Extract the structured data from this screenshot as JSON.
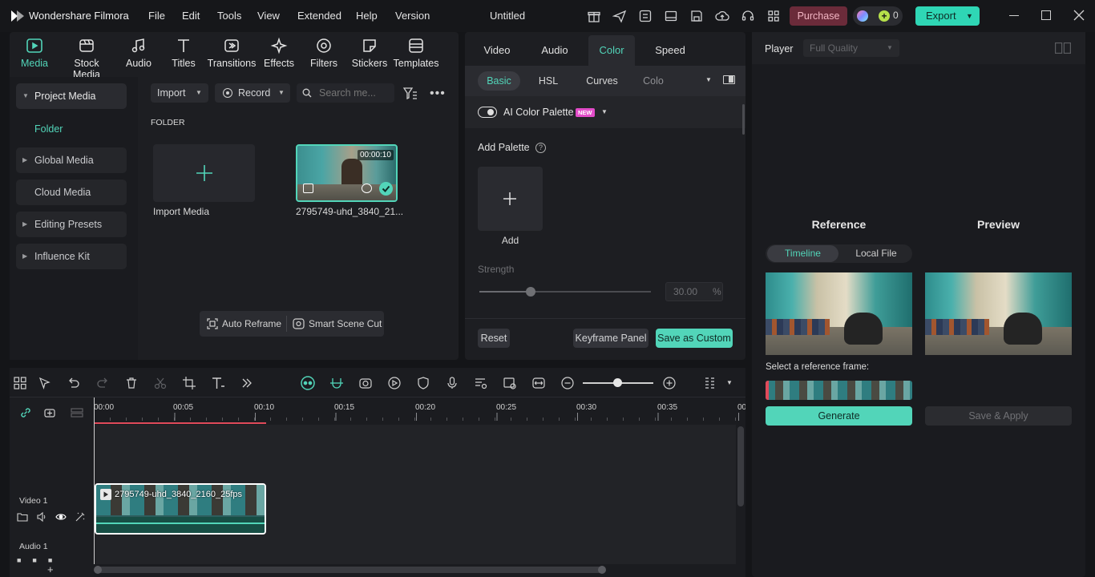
{
  "app": {
    "title": "Wondershare Filmora",
    "project": "Untitled"
  },
  "menu": [
    "File",
    "Edit",
    "Tools",
    "View",
    "Extended",
    "Help",
    "Version"
  ],
  "titlebar": {
    "purchase": "Purchase",
    "credits": "0",
    "export": "Export"
  },
  "media_tabs": [
    "Media",
    "Stock Media",
    "Audio",
    "Titles",
    "Transitions",
    "Effects",
    "Filters",
    "Stickers",
    "Templates"
  ],
  "sidebar": {
    "project_media": "Project Media",
    "folder": "Folder",
    "global_media": "Global Media",
    "cloud_media": "Cloud Media",
    "editing_presets": "Editing Presets",
    "influence_kit": "Influence Kit"
  },
  "media": {
    "import": "Import",
    "record": "Record",
    "search_placeholder": "Search me...",
    "folder_label": "FOLDER",
    "import_media": "Import Media",
    "clip_name": "2795749-uhd_3840_21...",
    "clip_duration": "00:00:10",
    "auto_reframe": "Auto Reframe",
    "smart_scene_cut": "Smart Scene Cut"
  },
  "props": {
    "tabs": [
      "Video",
      "Audio",
      "Color",
      "Speed"
    ],
    "subtabs": [
      "Basic",
      "HSL",
      "Curves",
      "Colo"
    ],
    "ai_palette": "AI Color Palette",
    "new_badge": "NEW",
    "add_palette": "Add Palette",
    "add": "Add",
    "strength": "Strength",
    "strength_value": "30.00",
    "strength_unit": "%",
    "strength_fraction": 0.3,
    "reset": "Reset",
    "keyframe": "Keyframe Panel",
    "save_custom": "Save as Custom"
  },
  "player": {
    "label": "Player",
    "quality": "Full Quality",
    "reference": "Reference",
    "preview": "Preview",
    "timeline_tab": "Timeline",
    "local_file_tab": "Local File",
    "select_frame": "Select a reference frame:",
    "generate": "Generate",
    "save_apply": "Save & Apply"
  },
  "timeline": {
    "ticks": [
      "00:00",
      "00:05",
      "00:10",
      "00:15",
      "00:20",
      "00:25",
      "00:30",
      "00:35",
      "00"
    ],
    "video_track": "Video 1",
    "audio_track": "Audio 1",
    "clip_label": "2795749-uhd_3840_2160_25fps"
  },
  "colors": {
    "accent": "#52d5b9",
    "purchase_bg": "#6b2b3a",
    "export_bg": "#2fd6b5"
  }
}
